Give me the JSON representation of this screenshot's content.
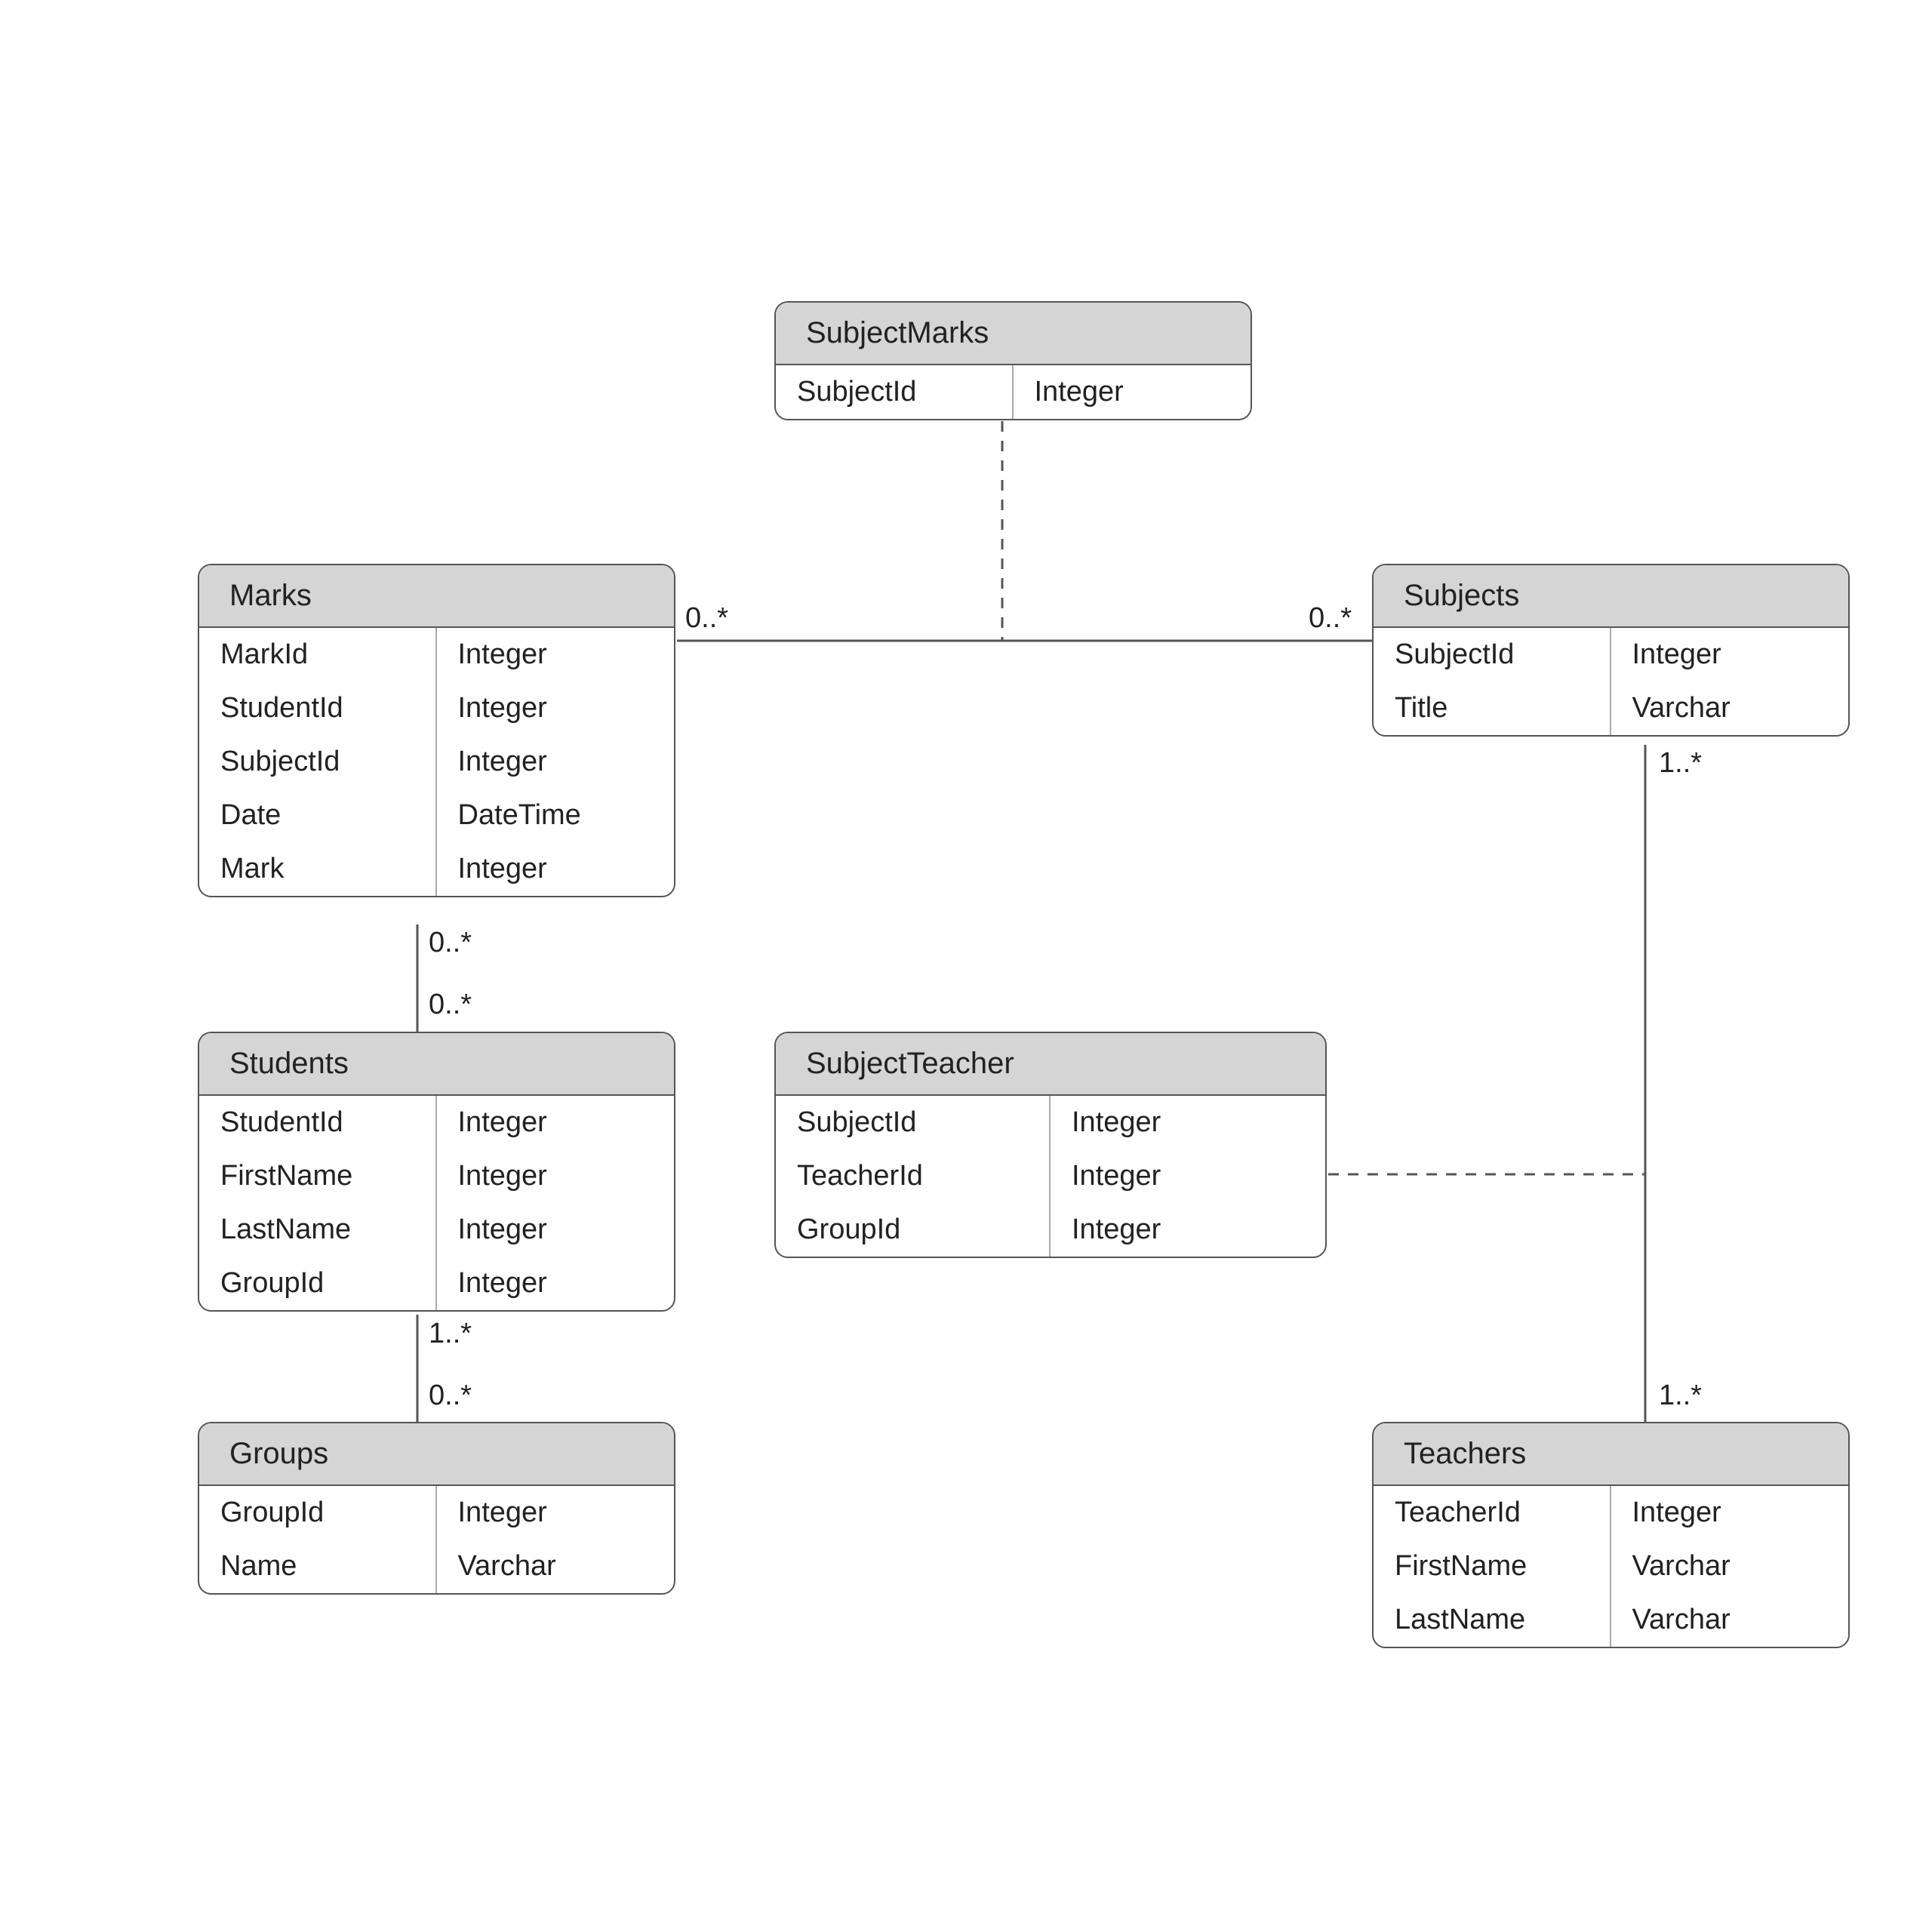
{
  "entities": {
    "subjectmarks": {
      "title": "SubjectMarks",
      "fields": [
        {
          "name": "SubjectId",
          "type": "Integer"
        }
      ]
    },
    "marks": {
      "title": "Marks",
      "fields": [
        {
          "name": "MarkId",
          "type": "Integer"
        },
        {
          "name": "StudentId",
          "type": "Integer"
        },
        {
          "name": "SubjectId",
          "type": "Integer"
        },
        {
          "name": "Date",
          "type": "DateTime"
        },
        {
          "name": "Mark",
          "type": "Integer"
        }
      ]
    },
    "subjects": {
      "title": "Subjects",
      "fields": [
        {
          "name": "SubjectId",
          "type": "Integer"
        },
        {
          "name": "Title",
          "type": "Varchar"
        }
      ]
    },
    "students": {
      "title": "Students",
      "fields": [
        {
          "name": "StudentId",
          "type": "Integer"
        },
        {
          "name": "FirstName",
          "type": "Integer"
        },
        {
          "name": "LastName",
          "type": "Integer"
        },
        {
          "name": "GroupId",
          "type": "Integer"
        }
      ]
    },
    "subjectteacher": {
      "title": "SubjectTeacher",
      "fields": [
        {
          "name": "SubjectId",
          "type": "Integer"
        },
        {
          "name": "TeacherId",
          "type": "Integer"
        },
        {
          "name": "GroupId",
          "type": "Integer"
        }
      ]
    },
    "groups": {
      "title": "Groups",
      "fields": [
        {
          "name": "GroupId",
          "type": "Integer"
        },
        {
          "name": "Name",
          "type": "Varchar"
        }
      ]
    },
    "teachers": {
      "title": "Teachers",
      "fields": [
        {
          "name": "TeacherId",
          "type": "Integer"
        },
        {
          "name": "FirstName",
          "type": "Varchar"
        },
        {
          "name": "LastName",
          "type": "Varchar"
        }
      ]
    }
  },
  "multiplicities": {
    "marks_right": "0..*",
    "subjects_left": "0..*",
    "marks_bottom": "0..*",
    "students_top": "0..*",
    "students_bottom": "1..*",
    "groups_top": "0..*",
    "subjects_bottom": "1..*",
    "teachers_top": "1..*"
  },
  "relationships": [
    {
      "from": "Marks",
      "to": "Subjects",
      "via": "SubjectMarks",
      "from_mult": "0..*",
      "to_mult": "0..*"
    },
    {
      "from": "Marks",
      "to": "Students",
      "from_mult": "0..*",
      "to_mult": "0..*"
    },
    {
      "from": "Students",
      "to": "Groups",
      "from_mult": "1..*",
      "to_mult": "0..*"
    },
    {
      "from": "Subjects",
      "to": "Teachers",
      "via": "SubjectTeacher",
      "from_mult": "1..*",
      "to_mult": "1..*"
    }
  ]
}
